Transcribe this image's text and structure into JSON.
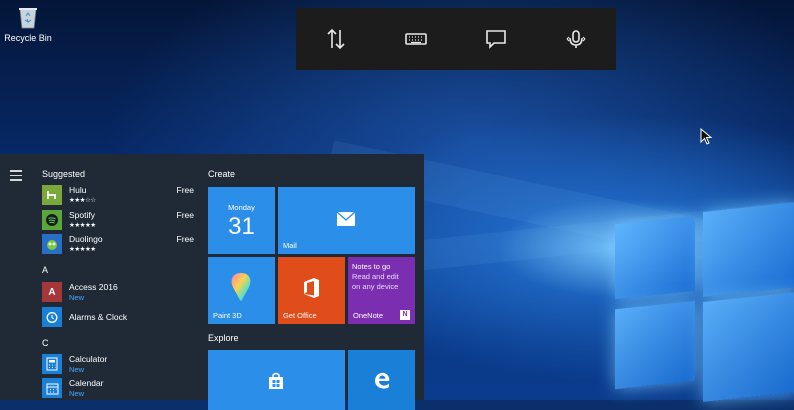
{
  "desktop": {
    "recycle_bin_label": "Recycle Bin"
  },
  "toolbar": {
    "buttons": [
      "transfer-arrows-icon",
      "keyboard-icon",
      "chat-icon",
      "microphone-icon"
    ]
  },
  "start_menu": {
    "suggested_header": "Suggested",
    "suggested": [
      {
        "name": "Hulu",
        "rating": "★★★☆☆",
        "price": "Free",
        "icon_color": "#7aa83a"
      },
      {
        "name": "Spotify",
        "rating": "★★★★★",
        "price": "Free",
        "icon_color": "#5aa63b"
      },
      {
        "name": "Duolingo",
        "rating": "★★★★★",
        "price": "Free",
        "icon_color": "#2a6fc7"
      }
    ],
    "groups": [
      {
        "letter": "A",
        "apps": [
          {
            "name": "Access 2016",
            "sub": "New",
            "icon_color": "#a4373a"
          },
          {
            "name": "Alarms & Clock",
            "sub": "",
            "icon_color": "#1a7fd6"
          }
        ]
      },
      {
        "letter": "C",
        "apps": [
          {
            "name": "Calculator",
            "sub": "New",
            "icon_color": "#1a7fd6"
          },
          {
            "name": "Calendar",
            "sub": "New",
            "icon_color": "#1a7fd6"
          }
        ]
      }
    ],
    "create_header": "Create",
    "explore_header": "Explore",
    "tiles": {
      "calendar": {
        "day": "Monday",
        "date": "31"
      },
      "mail": {
        "label": "Mail"
      },
      "paint3d": {
        "label": "Paint 3D"
      },
      "getoffice": {
        "label": "Get Office"
      },
      "onenote": {
        "label": "OneNote",
        "line1": "Notes to go",
        "line2": "Read and edit",
        "line3": "on any device"
      }
    },
    "colors": {
      "tile_blue": "#2b8ee8",
      "tile_orange": "#e04c1a",
      "tile_purple": "#7b2fb0"
    }
  }
}
